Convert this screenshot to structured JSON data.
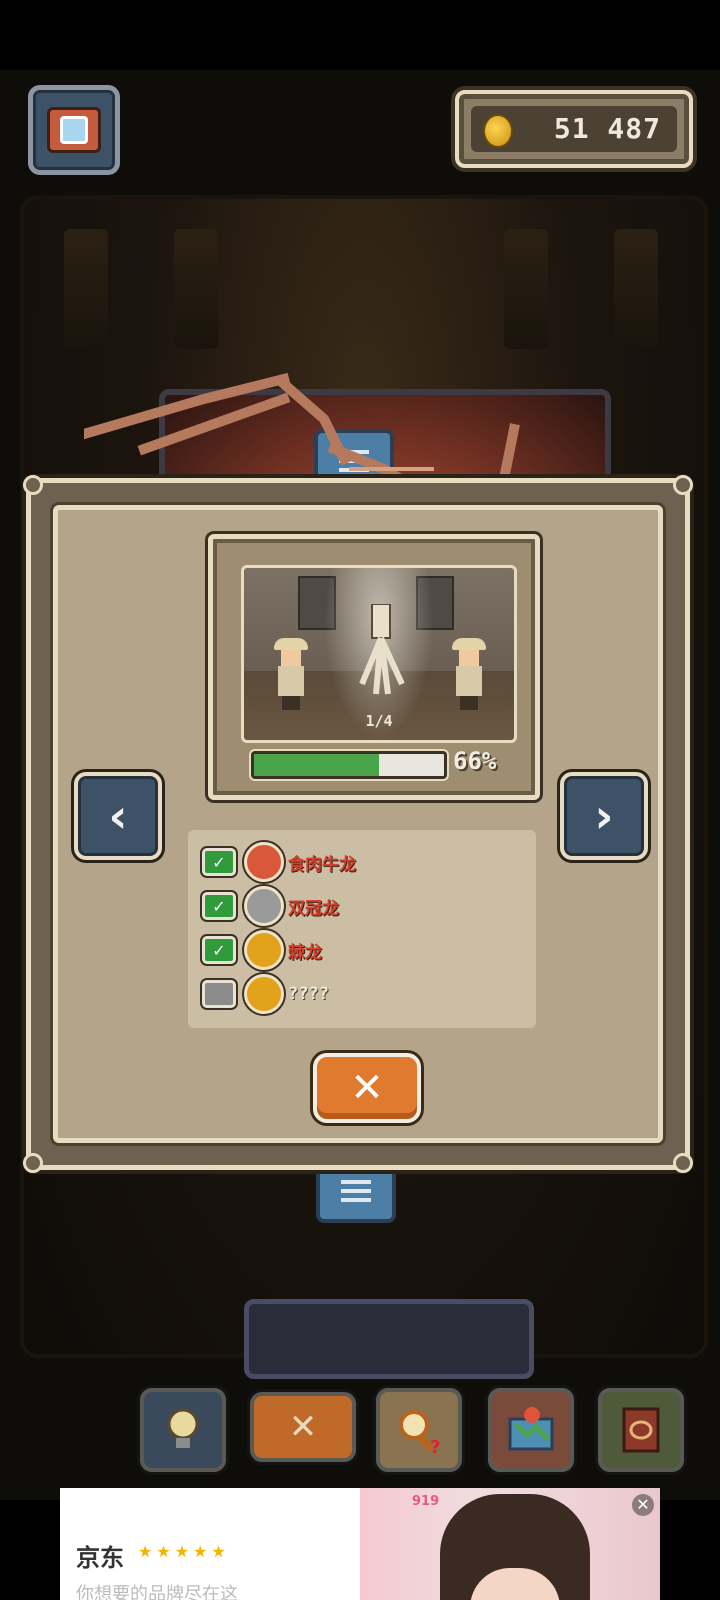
{
  "hud": {
    "coins": "51 487",
    "camera_icon": "camera-icon",
    "coin_icon": "gold-coin-icon"
  },
  "modal": {
    "page_indicator": "1/4",
    "progress_percent": 66,
    "progress_label": "66%",
    "prev_label": "‹",
    "next_label": "›",
    "close_label": "✕",
    "checklist": [
      {
        "name": "食肉牛龙",
        "checked": true,
        "badge_color": "#d9583c"
      },
      {
        "name": "双冠龙",
        "checked": true,
        "badge_color": "#9a9a9a"
      },
      {
        "name": "棘龙",
        "checked": true,
        "badge_color": "#e3a21c"
      },
      {
        "name": "????",
        "checked": false,
        "badge_color": "#e3a21c"
      }
    ]
  },
  "toolbar": {
    "items": [
      {
        "icon": "lightbulb-icon"
      },
      {
        "icon": "cancel-icon"
      },
      {
        "icon": "magnifier-question-icon"
      },
      {
        "icon": "map-pin-icon"
      },
      {
        "icon": "book-icon"
      }
    ]
  },
  "ad": {
    "brand": "京东",
    "stars": "★★★★★",
    "subtitle": "你想要的品牌尽在这",
    "tag": "919",
    "close": "✕"
  },
  "colors": {
    "accent_orange": "#e07a2e",
    "panel_tan": "#b4a489",
    "nav_blue": "#3e5267",
    "progress_green": "#4aa54a",
    "dino_red": "#d2422e"
  }
}
